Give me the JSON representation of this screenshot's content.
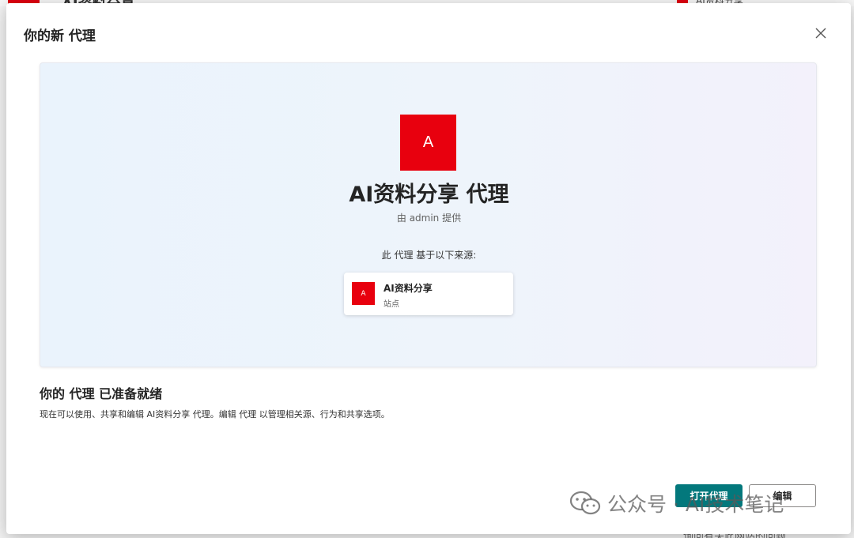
{
  "background": {
    "app_title": "AI资料分享",
    "right_title": "AI资料分享",
    "footer_text": "询问有关此网站的问题"
  },
  "dialog": {
    "title": "你的新 代理",
    "close_icon": "close-icon"
  },
  "hero": {
    "logo_letter": "A",
    "agent_title": "AI资料分享 代理",
    "provider": "由 admin 提供",
    "source_label": "此 代理 基于以下来源:",
    "source": {
      "logo_letter": "A",
      "name": "AI资料分享",
      "type": "站点"
    }
  },
  "ready": {
    "title": "你的 代理 已准备就绪",
    "description": "现在可以使用、共享和编辑 AI资料分享 代理。编辑 代理 以管理相关源、行为和共享选项。"
  },
  "actions": {
    "open_label": "打开代理",
    "edit_label": "编辑"
  },
  "watermark": {
    "text": "公众号 · AI技术笔记",
    "icon": "wechat-icon"
  },
  "colors": {
    "brand_red": "#e8000e",
    "primary_teal": "#03787c"
  }
}
